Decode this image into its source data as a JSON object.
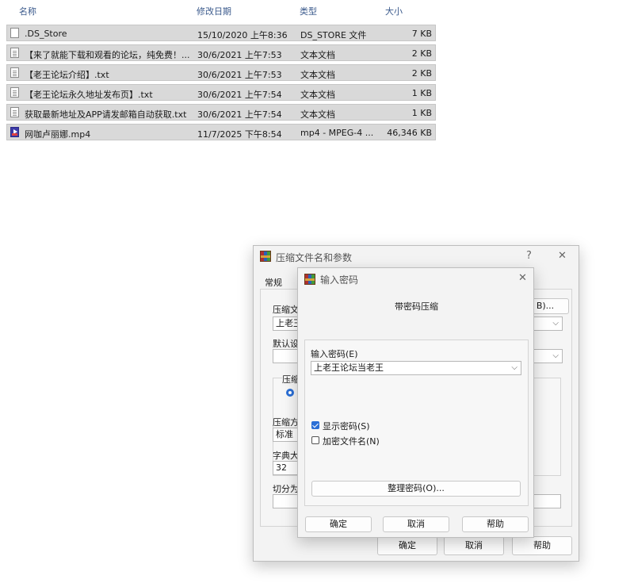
{
  "file_list": {
    "columns": {
      "name": "名称",
      "date": "修改日期",
      "type": "类型",
      "size": "大小"
    },
    "rows": [
      {
        "icon": "generic-file-icon",
        "name": ".DS_Store",
        "date": "15/10/2020 上午8:36",
        "type": "DS_STORE 文件",
        "size": "7 KB"
      },
      {
        "icon": "text-file-icon",
        "name": "【来了就能下载和观看的论坛，纯免费！...",
        "date": "30/6/2021 上午7:53",
        "type": "文本文档",
        "size": "2 KB"
      },
      {
        "icon": "text-file-icon",
        "name": "【老王论坛介绍】.txt",
        "date": "30/6/2021 上午7:53",
        "type": "文本文档",
        "size": "2 KB"
      },
      {
        "icon": "text-file-icon",
        "name": "【老王论坛永久地址发布页】.txt",
        "date": "30/6/2021 上午7:54",
        "type": "文本文档",
        "size": "1 KB"
      },
      {
        "icon": "text-file-icon",
        "name": "获取最新地址及APP请发邮箱自动获取.txt",
        "date": "30/6/2021 上午7:54",
        "type": "文本文档",
        "size": "1 KB"
      },
      {
        "icon": "video-file-icon",
        "name": "网咖卢丽娜.mp4",
        "date": "11/7/2025 下午8:54",
        "type": "mp4 - MPEG-4 ...",
        "size": "46,346 KB"
      }
    ]
  },
  "archive_dialog": {
    "title": "压缩文件名和参数",
    "help_glyph": "?",
    "close_glyph": "✕",
    "tab_general": "常规",
    "archive_name_label": "压缩文",
    "browse_label": "B)...",
    "archive_name_value": "上老王",
    "profile_label": "默认设",
    "format_label": "压缩",
    "method_label": "压缩方",
    "method_value": "标准",
    "dict_label": "字典大",
    "dict_value": "32",
    "split_label": "切分为",
    "ok": "确定",
    "cancel": "取消",
    "help": "帮助"
  },
  "password_dialog": {
    "title": "输入密码",
    "close_glyph": "✕",
    "heading": "带密码压缩",
    "password_label": "输入密码(E)",
    "password_value": "上老王论坛当老王",
    "show_password_label": "显示密码(S)",
    "show_password_checked": true,
    "encrypt_names_label": "加密文件名(N)",
    "encrypt_names_checked": false,
    "organize_button": "整理密码(O)...",
    "ok": "确定",
    "cancel": "取消",
    "help": "帮助"
  }
}
